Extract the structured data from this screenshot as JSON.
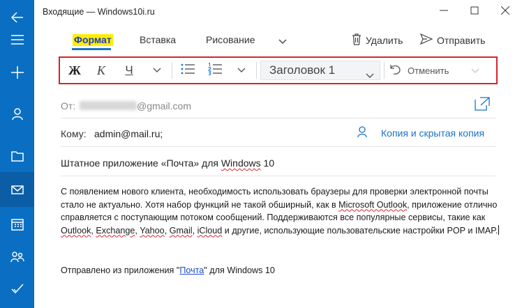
{
  "window": {
    "title": "Входящие — Windows10i.ru"
  },
  "rail": {
    "items": [
      {
        "icon": "back-arrow-icon"
      },
      {
        "icon": "hamburger-menu-icon"
      },
      {
        "icon": "new-mail-plus-icon"
      },
      {
        "icon": "accounts-person-icon"
      },
      {
        "icon": "folders-icon"
      },
      {
        "icon": "mail-icon",
        "active": true
      },
      {
        "icon": "calendar-icon"
      },
      {
        "icon": "people-icon"
      },
      {
        "icon": "todo-check-icon"
      }
    ]
  },
  "ribbon": {
    "tabs": [
      "Формат",
      "Вставка",
      "Рисование"
    ],
    "active_tab": "Формат",
    "delete_label": "Удалить",
    "send_label": "Отправить"
  },
  "toolbar": {
    "bold": "Ж",
    "italic": "К",
    "underline": "Ч",
    "style": "Заголовок 1",
    "undo": "Отменить"
  },
  "header": {
    "from_label": "От:",
    "from_domain": "@gmail.com",
    "to_label": "Кому:",
    "to_value": "admin@mail.ru;",
    "cc_bcc": "Копия и скрытая копия",
    "subject_before": "Штатное приложение «Почта» для ",
    "subject_spell": "Windows",
    "subject_after": " 10"
  },
  "body": {
    "p1_a": "С появлением нового клиента, необходимость использовать браузеры для проверки электронной почты стало не актуально. Хотя набор функций не такой обширный, как в ",
    "p1_msol": "Microsoft Outlook",
    "p1_b": ", приложение отлично справляется с поступающим потоком сообщений. Поддерживаются все популярные сервисы, такие как ",
    "outlook": "Outlook",
    "comma1": ", ",
    "exchange": "Exchange",
    "comma2": ", ",
    "yahoo": "Yahoo",
    "comma3": ", ",
    "gmail": "Gmail",
    "comma4": ", ",
    "icloud": "iCloud",
    "p1_c": " и другие, использующие пользовательские настройки POP и IMAP."
  },
  "signature": {
    "before": "Отправлено из приложения \"",
    "link": "Почта",
    "after": "\" для Windows 10"
  }
}
